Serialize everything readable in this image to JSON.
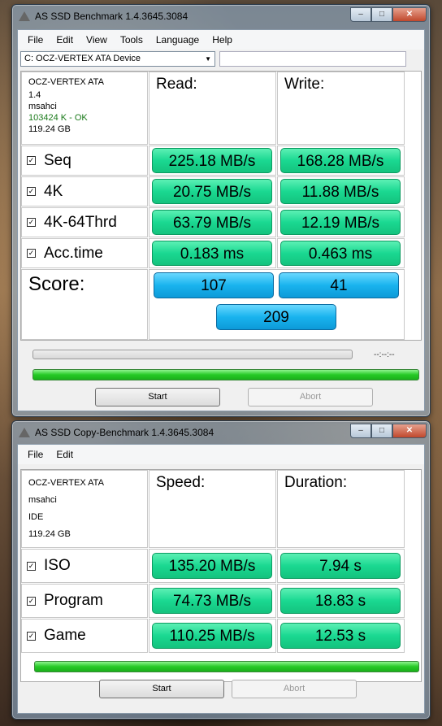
{
  "main_window": {
    "title": "AS SSD Benchmark 1.4.3645.3084",
    "menu": [
      "File",
      "Edit",
      "View",
      "Tools",
      "Language",
      "Help"
    ],
    "device_select": "C: OCZ-VERTEX ATA Device",
    "info": {
      "model": "OCZ-VERTEX ATA",
      "firmware": "1.4",
      "driver": "msahci",
      "alignment": "103424 K - OK",
      "size": "119.24 GB"
    },
    "headers": {
      "read": "Read:",
      "write": "Write:"
    },
    "rows": [
      {
        "label": "Seq",
        "read": "225.18 MB/s",
        "write": "168.28 MB/s"
      },
      {
        "label": "4K",
        "read": "20.75 MB/s",
        "write": "11.88 MB/s"
      },
      {
        "label": "4K-64Thrd",
        "read": "63.79 MB/s",
        "write": "12.19 MB/s"
      },
      {
        "label": "Acc.time",
        "read": "0.183 ms",
        "write": "0.463 ms"
      }
    ],
    "score": {
      "label": "Score:",
      "read": "107",
      "write": "41",
      "total": "209"
    },
    "timer": "--:--:--",
    "start_label": "Start",
    "abort_label": "Abort"
  },
  "copy_window": {
    "title": "AS SSD Copy-Benchmark 1.4.3645.3084",
    "menu": [
      "File",
      "Edit"
    ],
    "info": {
      "model": "OCZ-VERTEX ATA",
      "driver": "msahci",
      "mode": "IDE",
      "size": "119.24 GB"
    },
    "headers": {
      "speed": "Speed:",
      "duration": "Duration:"
    },
    "rows": [
      {
        "label": "ISO",
        "speed": "135.20 MB/s",
        "duration": "7.94 s"
      },
      {
        "label": "Program",
        "speed": "74.73 MB/s",
        "duration": "18.83 s"
      },
      {
        "label": "Game",
        "speed": "110.25 MB/s",
        "duration": "12.53 s"
      }
    ],
    "progress": 1.0,
    "start_label": "Start",
    "abort_label": "Abort"
  },
  "colors": {
    "value_green": "#1ad891",
    "score_blue": "#19b3ee",
    "progress_green": "#26c926"
  }
}
